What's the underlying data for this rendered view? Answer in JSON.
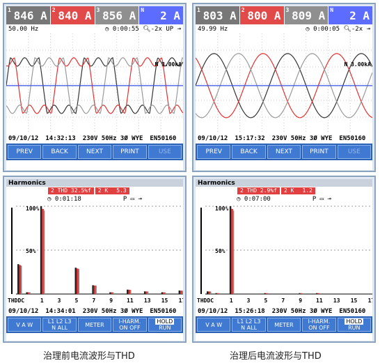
{
  "top_left": {
    "readings": [
      {
        "idx": "1",
        "value": "846 A"
      },
      {
        "idx": "2",
        "value": "840 A"
      },
      {
        "idx": "3",
        "value": "856 A"
      },
      {
        "idx": "N",
        "value": "2 A"
      }
    ],
    "freq": "50.00 Hz",
    "timer": "0:00:55",
    "zoom": "-2x",
    "mode": "UP",
    "scale_label": "N 3.00kA",
    "date": "09/10/12",
    "time": "14:32:13",
    "config": "230V 50Hz 3Ø WYE",
    "standard": "EN50160",
    "softkeys": [
      "PREV",
      "BACK",
      "NEXT",
      "PRINT",
      "USE"
    ]
  },
  "top_right": {
    "readings": [
      {
        "idx": "1",
        "value": "803 A"
      },
      {
        "idx": "2",
        "value": "800 A"
      },
      {
        "idx": "3",
        "value": "809 A"
      },
      {
        "idx": "N",
        "value": "2 A"
      }
    ],
    "freq": "49.99 Hz",
    "timer": "0:00:05",
    "zoom": "-2x",
    "scale_label": "N 3.00kA",
    "date": "09/10/12",
    "time": "15:17:32",
    "config": "230V 50Hz 3Ø WYE",
    "standard": "EN50160",
    "softkeys": [
      "PREV",
      "BACK",
      "NEXT",
      "PRINT",
      "USE"
    ]
  },
  "bottom_left": {
    "title": "Harmonics",
    "thd": "2 THD 32.5%f",
    "k": "2 K",
    "k_value": "5.3",
    "timer": "0:01:18",
    "pct100": "100%",
    "pct50": "50%",
    "ticks": [
      "THDDC",
      "1",
      "3",
      "5",
      "7",
      "9",
      "11",
      "13",
      "15",
      "17"
    ],
    "date": "09/10/12",
    "time": "14:34:01",
    "config": "230V 50Hz 3Ø WYE",
    "standard": "EN50160",
    "softkeys": {
      "vaw": "V A W",
      "phases": "L1 L2 L3",
      "phases2": "N ALL",
      "meter": "METER",
      "iharm": "I-HARM.",
      "iharm2": "ON OFF",
      "hold": "HOLD",
      "run": "RUN"
    },
    "bars": [
      {
        "h": 0.34,
        "pos": 0
      },
      {
        "h": 0.02,
        "pos": 0.5
      },
      {
        "h": 1.0,
        "pos": 1
      },
      {
        "h": 0.0,
        "pos": 2
      },
      {
        "h": 0.3,
        "pos": 3
      },
      {
        "h": 0.1,
        "pos": 4
      },
      {
        "h": 0.02,
        "pos": 5
      },
      {
        "h": 0.05,
        "pos": 6
      },
      {
        "h": 0.03,
        "pos": 7
      },
      {
        "h": 0.02,
        "pos": 8
      },
      {
        "h": 0.04,
        "pos": 9
      }
    ]
  },
  "bottom_right": {
    "title": "Harmonics",
    "thd": "2 THD 2.9%f",
    "k": "2 K",
    "k_value": "1.2",
    "timer": "0:07:00",
    "pct100": "100%",
    "pct50": "50%",
    "ticks": [
      "THDDC",
      "1",
      "3",
      "5",
      "7",
      "9",
      "11",
      "13",
      "15",
      "17"
    ],
    "date": "09/10/12",
    "time": "15:26:18",
    "config": "230V 50Hz 3Ø WYE",
    "standard": "EN50160",
    "softkeys": {
      "vaw": "V A W",
      "phases": "L1 L2 L3",
      "phases2": "N ALL",
      "meter": "METER",
      "iharm": "I-HARM.",
      "iharm2": "ON OFF",
      "hold": "HOLD",
      "run": "RUN"
    },
    "bars": [
      {
        "h": 0.03,
        "pos": 0
      },
      {
        "h": 0.01,
        "pos": 0.5
      },
      {
        "h": 1.0,
        "pos": 1
      },
      {
        "h": 0.0,
        "pos": 2
      },
      {
        "h": 0.01,
        "pos": 3
      },
      {
        "h": 0.0,
        "pos": 4
      },
      {
        "h": 0.01,
        "pos": 5
      },
      {
        "h": 0.01,
        "pos": 6
      },
      {
        "h": 0.0,
        "pos": 7
      },
      {
        "h": 0.0,
        "pos": 8
      },
      {
        "h": 0.0,
        "pos": 9
      }
    ]
  },
  "captions": {
    "left": "治理前电流波形与THD",
    "right": "治理后电流波形与THD"
  },
  "colors": {
    "l1": "#333333",
    "l2": "#e23030",
    "l3": "#999999",
    "n": "#3350e0"
  }
}
